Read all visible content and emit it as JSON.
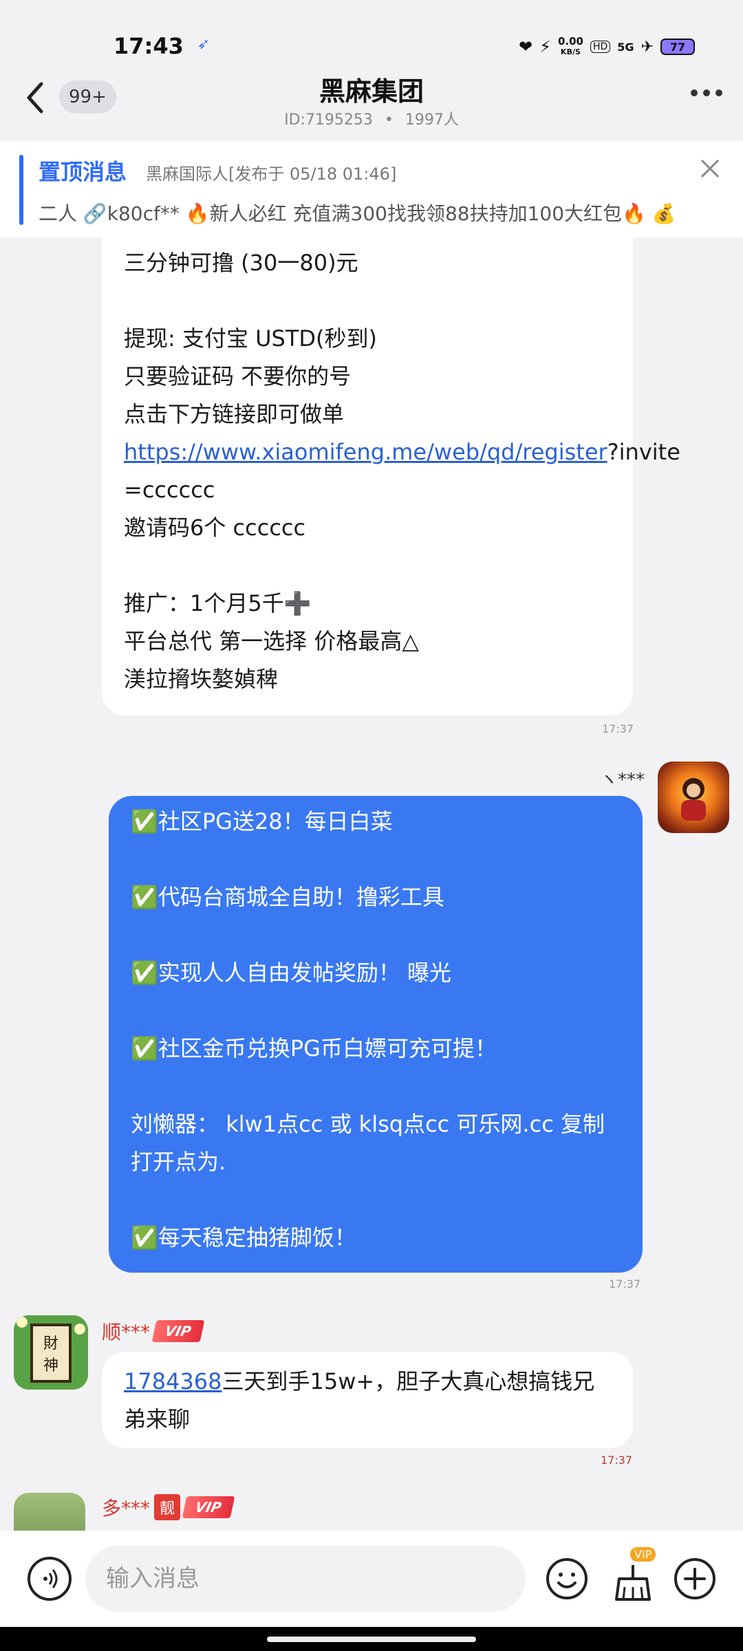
{
  "status": {
    "time": "17:43",
    "net_speed": "0.00",
    "net_unit": "KB/S",
    "network": "5G",
    "battery": "77"
  },
  "header": {
    "unread_badge": "99+",
    "title": "黑麻集团",
    "id_text": "ID:7195253",
    "separator": "•",
    "member_count": "1997人"
  },
  "pinned": {
    "label": "置顶消息",
    "meta": "黑麻国际人[发布于 05/18 01:46]",
    "text": "二人 🔗k80cf** 🔥新人必红 充值满300找我领88扶持加100大红包🔥 💰"
  },
  "messages": {
    "m1": {
      "lines": [
        "三分钟可撸 (30一80)元",
        "",
        "提现: 支付宝 USTD(秒到)",
        "只要验证码 不要你的号",
        "点击下方链接即可做单"
      ],
      "link": "https://www.xiaomifeng.me/web/qd/register",
      "link_suffix": "?invite",
      "after_link": [
        "=cccccc",
        "邀请码6个 cccccc",
        "",
        "推广：1个月5千➕",
        "平台总代 第一选择 价格最高△",
        "渼拉搚垁嫯媜稗"
      ],
      "time": "17:37"
    },
    "m2": {
      "nick": "ヽ***",
      "lines": [
        "✅社区PG送28！每日白菜",
        "",
        "✅代码台商城全自助！撸彩工具",
        "",
        "✅实现人人自由发帖奖励！ 曝光",
        "",
        "✅社区金币兑换PG币白嫖可充可提！",
        "",
        "刘懒器： klw1点cc 或 klsq点cc 可乐网.cc  复制",
        "打开点为.",
        "",
        "✅每天稳定抽猪脚饭！"
      ],
      "time": "17:37"
    },
    "m3": {
      "nick": "顺***",
      "vip": "VIP",
      "link": "1784368",
      "text1": "三天到手15w+，胆子大真心想搞钱兄",
      "text2": "弟来聊",
      "time": "17:37"
    },
    "m4": {
      "nick": "多***",
      "liang": "靓",
      "vip": "VIP"
    }
  },
  "input": {
    "placeholder": "输入消息",
    "vip_tag": "VIP"
  }
}
